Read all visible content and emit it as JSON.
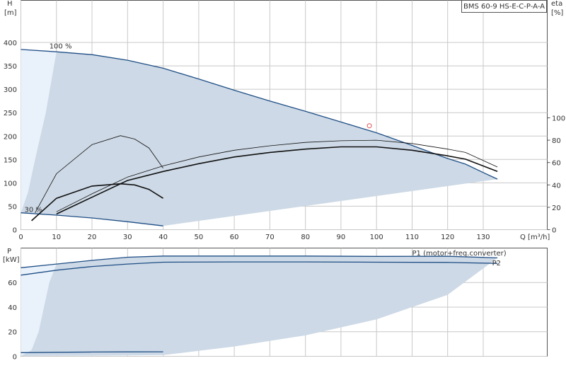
{
  "colors": {
    "envelope_fill": "#cdd9e6",
    "light_fill": "#e9f2fb",
    "boundary_line": "#1f4e85",
    "efficiency_line": "#111111",
    "grid": "#c8c8c8",
    "marker": "#e05050",
    "p1_text": "#1f4e85"
  },
  "header": {
    "title": "BMS 60-9 HS-E-C-P-A-A"
  },
  "chart_data": [
    {
      "type": "line",
      "panel": "head-efficiency",
      "xlabel": "Q [m³/h]",
      "ylabel_left": "H",
      "ylabel_left_unit": "[m]",
      "ylabel_right": "eta",
      "ylabel_right_unit": "[%]",
      "xlim": [
        0,
        148
      ],
      "ylim_left": [
        0,
        490
      ],
      "ylim_right": [
        0,
        205
      ],
      "x_ticks": [
        0,
        10,
        20,
        30,
        40,
        50,
        60,
        70,
        80,
        90,
        100,
        110,
        120,
        130
      ],
      "y_ticks_left": [
        0,
        50,
        100,
        150,
        200,
        250,
        300,
        350,
        400
      ],
      "y_ticks_right": [
        0,
        20,
        40,
        60,
        80,
        100
      ],
      "annotations": [
        {
          "text": "100 %",
          "x": 8,
          "y": 387
        },
        {
          "text": "30 %",
          "x": 1,
          "y": 38
        }
      ],
      "marker_point": {
        "x": 98,
        "y": 222
      },
      "series": [
        {
          "role": "envelope",
          "x": [
            0,
            10,
            20,
            30,
            40,
            50,
            60,
            70,
            80,
            90,
            100,
            110,
            120,
            125,
            130,
            134,
            40,
            30,
            20,
            10,
            0
          ],
          "y": [
            385,
            380,
            374,
            362,
            345,
            322,
            298,
            275,
            253,
            230,
            207,
            180,
            152,
            140,
            122,
            108,
            8,
            17,
            25,
            31,
            36
          ]
        },
        {
          "role": "light",
          "x": [
            0,
            10,
            7,
            4,
            2,
            0
          ],
          "y": [
            385,
            380,
            250,
            150,
            80,
            36
          ]
        },
        {
          "role": "efficiency-max-thin",
          "axis": "right",
          "x": [
            4,
            10,
            20,
            28,
            32,
            36,
            40
          ],
          "y": [
            15,
            50,
            76,
            84,
            81,
            73,
            55
          ]
        },
        {
          "role": "efficiency-min-thick",
          "axis": "right",
          "x": [
            3,
            10,
            20,
            28,
            32,
            36,
            40
          ],
          "y": [
            8,
            28,
            39,
            41,
            40,
            36,
            28
          ]
        },
        {
          "role": "efficiency-full-thin",
          "axis": "right",
          "x": [
            10,
            20,
            30,
            40,
            50,
            60,
            70,
            80,
            90,
            100,
            110,
            120,
            125,
            134
          ],
          "y": [
            16,
            32,
            47,
            57,
            65,
            71,
            75,
            78,
            79.5,
            80,
            77,
            72,
            69,
            56
          ]
        },
        {
          "role": "efficiency-full-thick",
          "axis": "right",
          "x": [
            10,
            20,
            30,
            40,
            50,
            60,
            70,
            80,
            90,
            100,
            110,
            120,
            125,
            134
          ],
          "y": [
            14,
            29,
            44,
            52,
            59,
            65,
            69,
            72,
            74,
            74,
            71,
            66,
            63,
            52
          ]
        }
      ]
    },
    {
      "type": "line",
      "panel": "power",
      "xlim": [
        0,
        148
      ],
      "ylim": [
        0,
        88
      ],
      "ylabel": "P",
      "ylabel_unit": "[kW]",
      "y_ticks": [
        0,
        20,
        40,
        60
      ],
      "series": [
        {
          "name": "P1 (motor+freq.converter)",
          "label_x": 110,
          "label_y": 82,
          "x": [
            0,
            10,
            20,
            30,
            40,
            60,
            80,
            100,
            120,
            134
          ],
          "y": [
            72,
            75,
            78,
            80.5,
            81.5,
            81.5,
            81.5,
            81.2,
            81.3,
            80
          ]
        },
        {
          "name": "P2",
          "label_x": 132.5,
          "label_y": 74,
          "x": [
            0,
            10,
            20,
            30,
            40,
            60,
            80,
            100,
            120,
            134
          ],
          "y": [
            66,
            70,
            73,
            75,
            76.5,
            76.7,
            76.7,
            76.5,
            76.3,
            75.5
          ]
        },
        {
          "role": "low-speed-band",
          "x": [
            0,
            10,
            20,
            30,
            40
          ],
          "y": [
            3,
            3.3,
            3.5,
            3.6,
            3.7
          ]
        },
        {
          "role": "envelope",
          "x": [
            0,
            10,
            20,
            30,
            40,
            60,
            80,
            100,
            120,
            134,
            120,
            100,
            80,
            60,
            40,
            30,
            20,
            10,
            0
          ],
          "y": [
            72,
            75,
            78,
            80.5,
            81.5,
            81.5,
            81.5,
            81.2,
            81.3,
            80,
            50,
            30,
            17,
            8,
            1,
            0.7,
            0.5,
            0.4,
            0.3
          ]
        },
        {
          "role": "light",
          "x": [
            0,
            10,
            8,
            5,
            3,
            0
          ],
          "y": [
            72,
            75,
            60,
            20,
            5,
            0.3
          ]
        }
      ]
    }
  ]
}
